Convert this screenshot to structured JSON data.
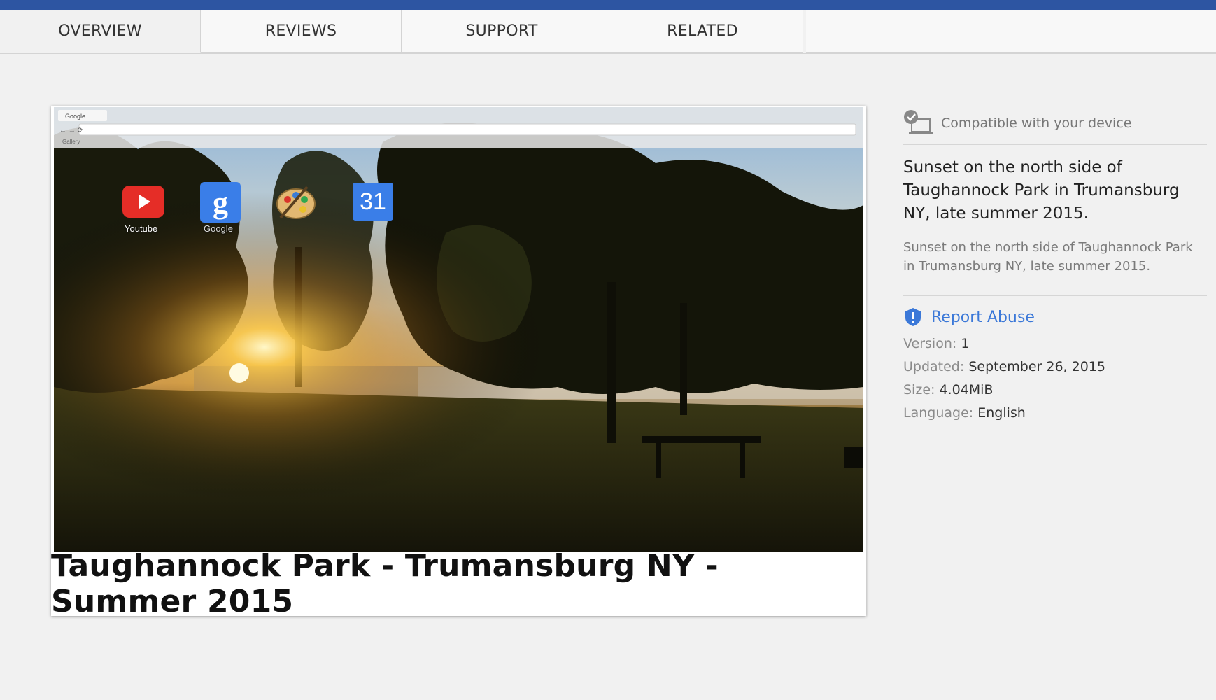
{
  "tabs": [
    {
      "label": "OVERVIEW"
    },
    {
      "label": "REVIEWS"
    },
    {
      "label": "SUPPORT"
    },
    {
      "label": "RELATED"
    }
  ],
  "screenshot": {
    "apps": [
      {
        "label": "Youtube",
        "icon": "youtube-icon"
      },
      {
        "label": "Google",
        "icon": "google-icon"
      },
      {
        "label": "",
        "icon": "paint-palette-icon"
      },
      {
        "label": "31",
        "icon": "calendar-icon"
      }
    ],
    "caption": "Taughannock Park - Trumansburg NY - Summer 2015"
  },
  "sidebar": {
    "compatibility": "Compatible with your device",
    "description_title": "Sunset on the north side of Taughannock Park in Trumansburg NY, late summer 2015.",
    "description": "Sunset on the north side of Taughannock Park in Trumansburg NY, late summer 2015.",
    "report_abuse": "Report Abuse",
    "meta": {
      "version_label": "Version: ",
      "version": "1",
      "updated_label": "Updated: ",
      "updated": "September 26, 2015",
      "size_label": "Size: ",
      "size": "4.04MiB",
      "language_label": "Language: ",
      "language": "English"
    }
  },
  "colors": {
    "topbar": "#2d55a2",
    "link": "#3b78d8"
  }
}
